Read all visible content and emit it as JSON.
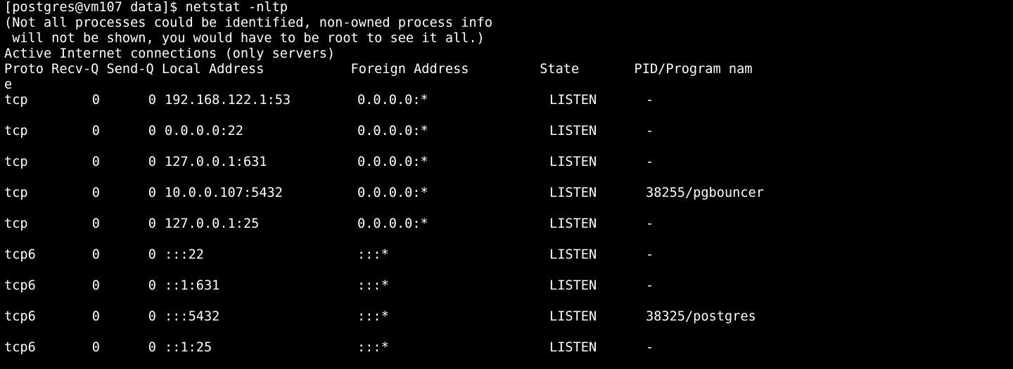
{
  "terminal": {
    "prompt_line": "[postgres@vm107 data]$ netstat -nltp",
    "notice_line_1": "(Not all processes could be identified, non-owned process info",
    "notice_line_2": " will not be shown, you would have to be root to see it all.)",
    "section_title": "Active Internet connections (only servers)",
    "header_line": "Proto Recv-Q Send-Q Local Address           Foreign Address         State       PID/Program nam",
    "header_wrap": "e",
    "background_color": "#000000",
    "text_color": "#ffffff"
  },
  "connections": [
    {
      "proto": "tcp",
      "recv_q": "0",
      "send_q": "0",
      "local": "192.168.122.1:53",
      "foreign": "0.0.0.0:*",
      "state": "LISTEN",
      "pid": "-"
    },
    {
      "proto": "tcp",
      "recv_q": "0",
      "send_q": "0",
      "local": "0.0.0.0:22",
      "foreign": "0.0.0.0:*",
      "state": "LISTEN",
      "pid": "-"
    },
    {
      "proto": "tcp",
      "recv_q": "0",
      "send_q": "0",
      "local": "127.0.0.1:631",
      "foreign": "0.0.0.0:*",
      "state": "LISTEN",
      "pid": "-"
    },
    {
      "proto": "tcp",
      "recv_q": "0",
      "send_q": "0",
      "local": "10.0.0.107:5432",
      "foreign": "0.0.0.0:*",
      "state": "LISTEN",
      "pid": "38255/pgbouncer"
    },
    {
      "proto": "tcp",
      "recv_q": "0",
      "send_q": "0",
      "local": "127.0.0.1:25",
      "foreign": "0.0.0.0:*",
      "state": "LISTEN",
      "pid": "-"
    },
    {
      "proto": "tcp6",
      "recv_q": "0",
      "send_q": "0",
      "local": ":::22",
      "foreign": ":::*",
      "state": "LISTEN",
      "pid": "-"
    },
    {
      "proto": "tcp6",
      "recv_q": "0",
      "send_q": "0",
      "local": "::1:631",
      "foreign": ":::*",
      "state": "LISTEN",
      "pid": "-"
    },
    {
      "proto": "tcp6",
      "recv_q": "0",
      "send_q": "0",
      "local": ":::5432",
      "foreign": ":::*",
      "state": "LISTEN",
      "pid": "38325/postgres"
    },
    {
      "proto": "tcp6",
      "recv_q": "0",
      "send_q": "0",
      "local": "::1:25",
      "foreign": ":::*",
      "state": "LISTEN",
      "pid": "-"
    }
  ]
}
